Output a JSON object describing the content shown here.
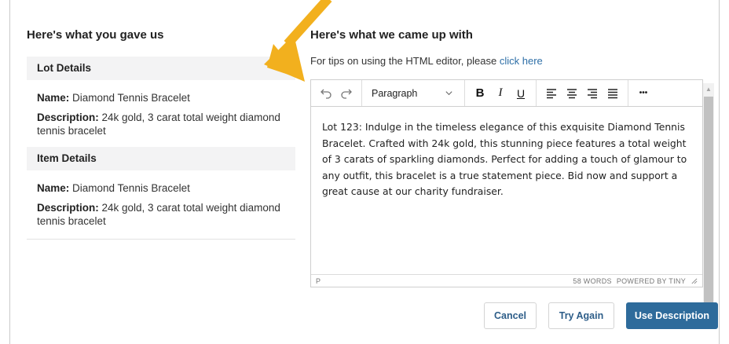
{
  "left": {
    "title": "Here's what you gave us",
    "lot_section": "Lot Details",
    "lot_name_label": "Name:",
    "lot_name": " Diamond Tennis Bracelet",
    "lot_desc_label": "Description:",
    "lot_desc": " 24k gold, 3 carat total weight diamond tennis bracelet",
    "item_section": "Item Details",
    "item_name_label": "Name:",
    "item_name": " Diamond Tennis Bracelet",
    "item_desc_label": "Description:",
    "item_desc": " 24k gold, 3 carat total weight diamond tennis bracelet"
  },
  "right": {
    "title": "Here's what we came up with",
    "tips_text": "For tips on using the HTML editor, please ",
    "tips_link": "click here"
  },
  "editor": {
    "block_format": "Paragraph",
    "bold_label": "B",
    "italic_label": "I",
    "underline_label": "U",
    "more_label": "•••",
    "content": "Lot 123: Indulge in the timeless elegance of this exquisite Diamond Tennis Bracelet. Crafted with 24k gold, this stunning piece features a total weight of 3 carats of sparkling diamonds. Perfect for adding a touch of glamour to any outfit, this bracelet is a true statement piece. Bid now and support a great cause at our charity fundraiser.",
    "status_path": "P",
    "word_count": "58 WORDS",
    "powered_by": "POWERED BY TINY"
  },
  "buttons": {
    "cancel": "Cancel",
    "try_again": "Try Again",
    "use_description": "Use Description"
  },
  "colors": {
    "link": "#2e6fa7",
    "primary": "#2e6b9b",
    "arrow": "#f2b01e"
  },
  "icons": [
    "undo-icon",
    "redo-icon",
    "chevron-down-icon",
    "align-left-icon",
    "align-center-icon",
    "align-right-icon",
    "align-justify-icon",
    "resize-handle-icon",
    "arrow-annotation"
  ]
}
